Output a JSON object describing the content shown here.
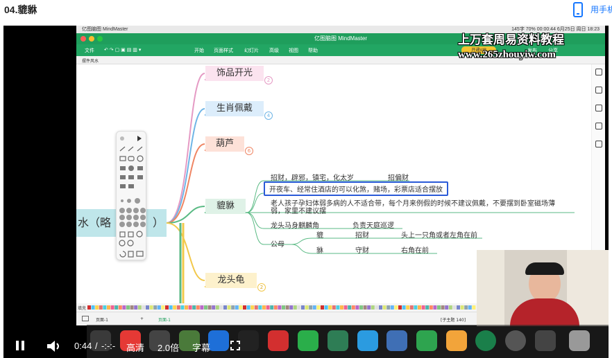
{
  "page": {
    "lesson_title": "04.貔貅",
    "top_link": "用手机"
  },
  "mac_menubar": {
    "left": "亿图脑图 MindMaster",
    "right": "145字  70%  00:00:44  6月25日 周日 18:23"
  },
  "app": {
    "window_title": "亿图脑图 MindMaster",
    "menu": [
      "文件",
      "开始",
      "页面样式",
      "幻灯片",
      "高级",
      "视图",
      "帮助"
    ],
    "right_menu": [
      "发布",
      "分享"
    ],
    "vip_label": "开通VIP",
    "tab_label": "摆件风水"
  },
  "watermark": {
    "line1": "上万套周易资料教程",
    "line2": "www.265zhouyiw.com"
  },
  "mindmap": {
    "root": "水（略",
    "root_tail": "）",
    "branches": [
      {
        "label": "饰品开光",
        "count": "2",
        "color": "#e59ac4",
        "fill": "#fbe3ef"
      },
      {
        "label": "生肖佩戴",
        "count": "4",
        "color": "#6fb5e6",
        "fill": "#dcedfb"
      },
      {
        "label": "葫芦",
        "count": "6",
        "color": "#ef8563",
        "fill": "#fde1d8"
      },
      {
        "label": "貔貅",
        "count": "",
        "color": "#5aba84",
        "fill": "#dff2e7"
      },
      {
        "label": "龙头龟",
        "count": "2",
        "color": "#f2c84b",
        "fill": "#fdf1cc"
      }
    ],
    "pixiu_items": {
      "row1_a": "招财，辟邪，镇宅，化太岁",
      "row1_b": "招偏财",
      "row2": "开夜车、经常住酒店的可以化煞，赌场，彩票店适合摆放",
      "row3_line1": "老人孩子孕妇体弱多病的人不适合带，每个月来例假的时候不建议佩戴，不要摆到卧室磁场薄",
      "row3_line2": "弱，家里不建议摆",
      "row4_a": "龙头马身麒麟角",
      "row4_b": "负责天庭巡逻",
      "gender_label": "公母",
      "male_name": "貔",
      "male_role": "招财",
      "male_pos": "头上一只角或者左角在前",
      "female_name": "貅",
      "female_role": "守财",
      "female_pos": "右角在前"
    }
  },
  "statusbar": {
    "page_left": "页面-1",
    "page_tab": "页面-1",
    "add": "+",
    "subject_count": "[子主题 140]",
    "palette_label": "填充"
  },
  "player": {
    "time": "0:44",
    "separator": "/",
    "duration": "-:-:-",
    "quality": "高清",
    "speed": "2.0倍",
    "subtitle": "字幕"
  },
  "colors": {
    "app_green": "#22a663",
    "highlight_blue": "#2a5ad7",
    "root_fill": "#bfe6ea"
  }
}
